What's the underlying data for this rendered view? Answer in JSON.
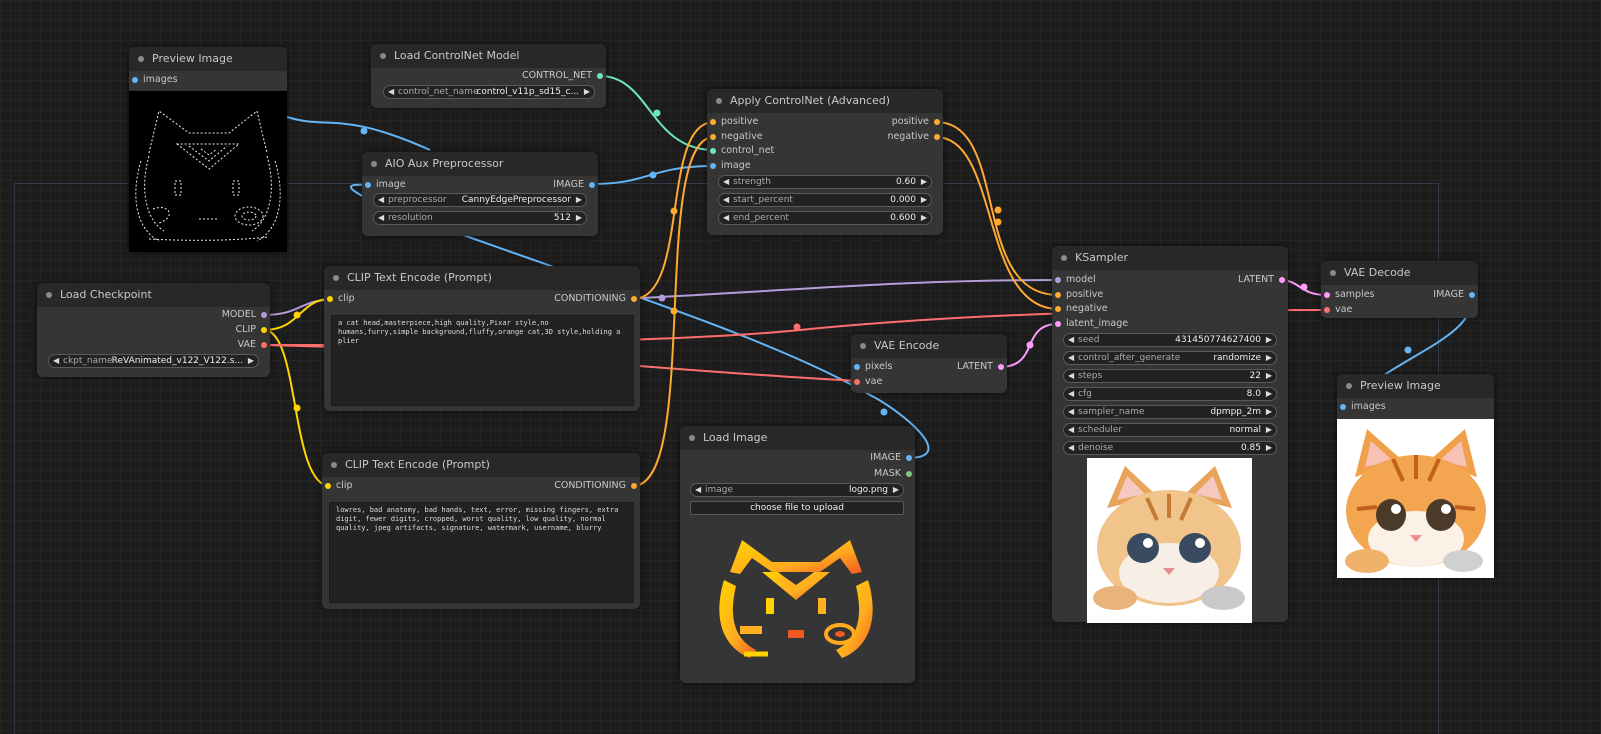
{
  "colors": {
    "model": "#b39ddb",
    "clip": "#ffd500",
    "vae": "#ff6e6e",
    "conditioning": "#ffa931",
    "control_net": "#6ee7b7",
    "image": "#64b5f6",
    "latent": "#ff9cf9",
    "mask": "#81c784"
  },
  "icons": {
    "left": "◀",
    "right": "▶"
  },
  "preview1": {
    "title": "Preview Image",
    "in_images": "images"
  },
  "cn_loader": {
    "title": "Load ControlNet Model",
    "out_control_net": "CONTROL_NET",
    "w_label": "control_net_name",
    "w_value": "control_v11p_sd15_c..."
  },
  "apply_cn": {
    "title": "Apply ControlNet (Advanced)",
    "in_positive": "positive",
    "in_negative": "negative",
    "in_control_net": "control_net",
    "in_image": "image",
    "out_positive": "positive",
    "out_negative": "negative",
    "strength_label": "strength",
    "strength_value": "0.60",
    "start_label": "start_percent",
    "start_value": "0.000",
    "end_label": "end_percent",
    "end_value": "0.600"
  },
  "aio": {
    "title": "AIO Aux Preprocessor",
    "in_image": "image",
    "out_image": "IMAGE",
    "pre_label": "preprocessor",
    "pre_value": "CannyEdgePreprocessor",
    "res_label": "resolution",
    "res_value": "512"
  },
  "ckpt": {
    "title": "Load Checkpoint",
    "out_model": "MODEL",
    "out_clip": "CLIP",
    "out_vae": "VAE",
    "w_label": "ckpt_name",
    "w_value": "ReVAnimated_v122_V122.s..."
  },
  "clip_pos": {
    "title": "CLIP Text Encode (Prompt)",
    "in_clip": "clip",
    "out_cond": "CONDITIONING",
    "text": "a cat head,masterpiece,high quality,Pixar style,no humans,furry,simple background,fluffy,orange cat,3D style,holding a plier"
  },
  "clip_neg": {
    "title": "CLIP Text Encode (Prompt)",
    "in_clip": "clip",
    "out_cond": "CONDITIONING",
    "text": "lowres, bad anatomy, bad hands, text, error, missing fingers, extra digit, fewer digits, cropped, worst quality, low quality, normal quality, jpeg artifacts, signature, watermark, username, blurry"
  },
  "vae_encode": {
    "title": "VAE Encode",
    "in_pixels": "pixels",
    "in_vae": "vae",
    "out_latent": "LATENT"
  },
  "load_image": {
    "title": "Load Image",
    "out_image": "IMAGE",
    "out_mask": "MASK",
    "w_label": "image",
    "w_value": "logo.png",
    "upload": "choose file to upload"
  },
  "ksampler": {
    "title": "KSampler",
    "in_model": "model",
    "in_positive": "positive",
    "in_negative": "negative",
    "in_latent": "latent_image",
    "out_latent": "LATENT",
    "widgets": [
      {
        "label": "seed",
        "value": "431450774627400"
      },
      {
        "label": "control_after_generate",
        "value": "randomize"
      },
      {
        "label": "steps",
        "value": "22"
      },
      {
        "label": "cfg",
        "value": "8.0"
      },
      {
        "label": "sampler_name",
        "value": "dpmpp_2m"
      },
      {
        "label": "scheduler",
        "value": "normal"
      },
      {
        "label": "denoise",
        "value": "0.85"
      }
    ]
  },
  "vae_decode": {
    "title": "VAE Decode",
    "in_samples": "samples",
    "in_vae": "vae",
    "out_image": "IMAGE"
  },
  "preview2": {
    "title": "Preview Image",
    "in_images": "images"
  }
}
